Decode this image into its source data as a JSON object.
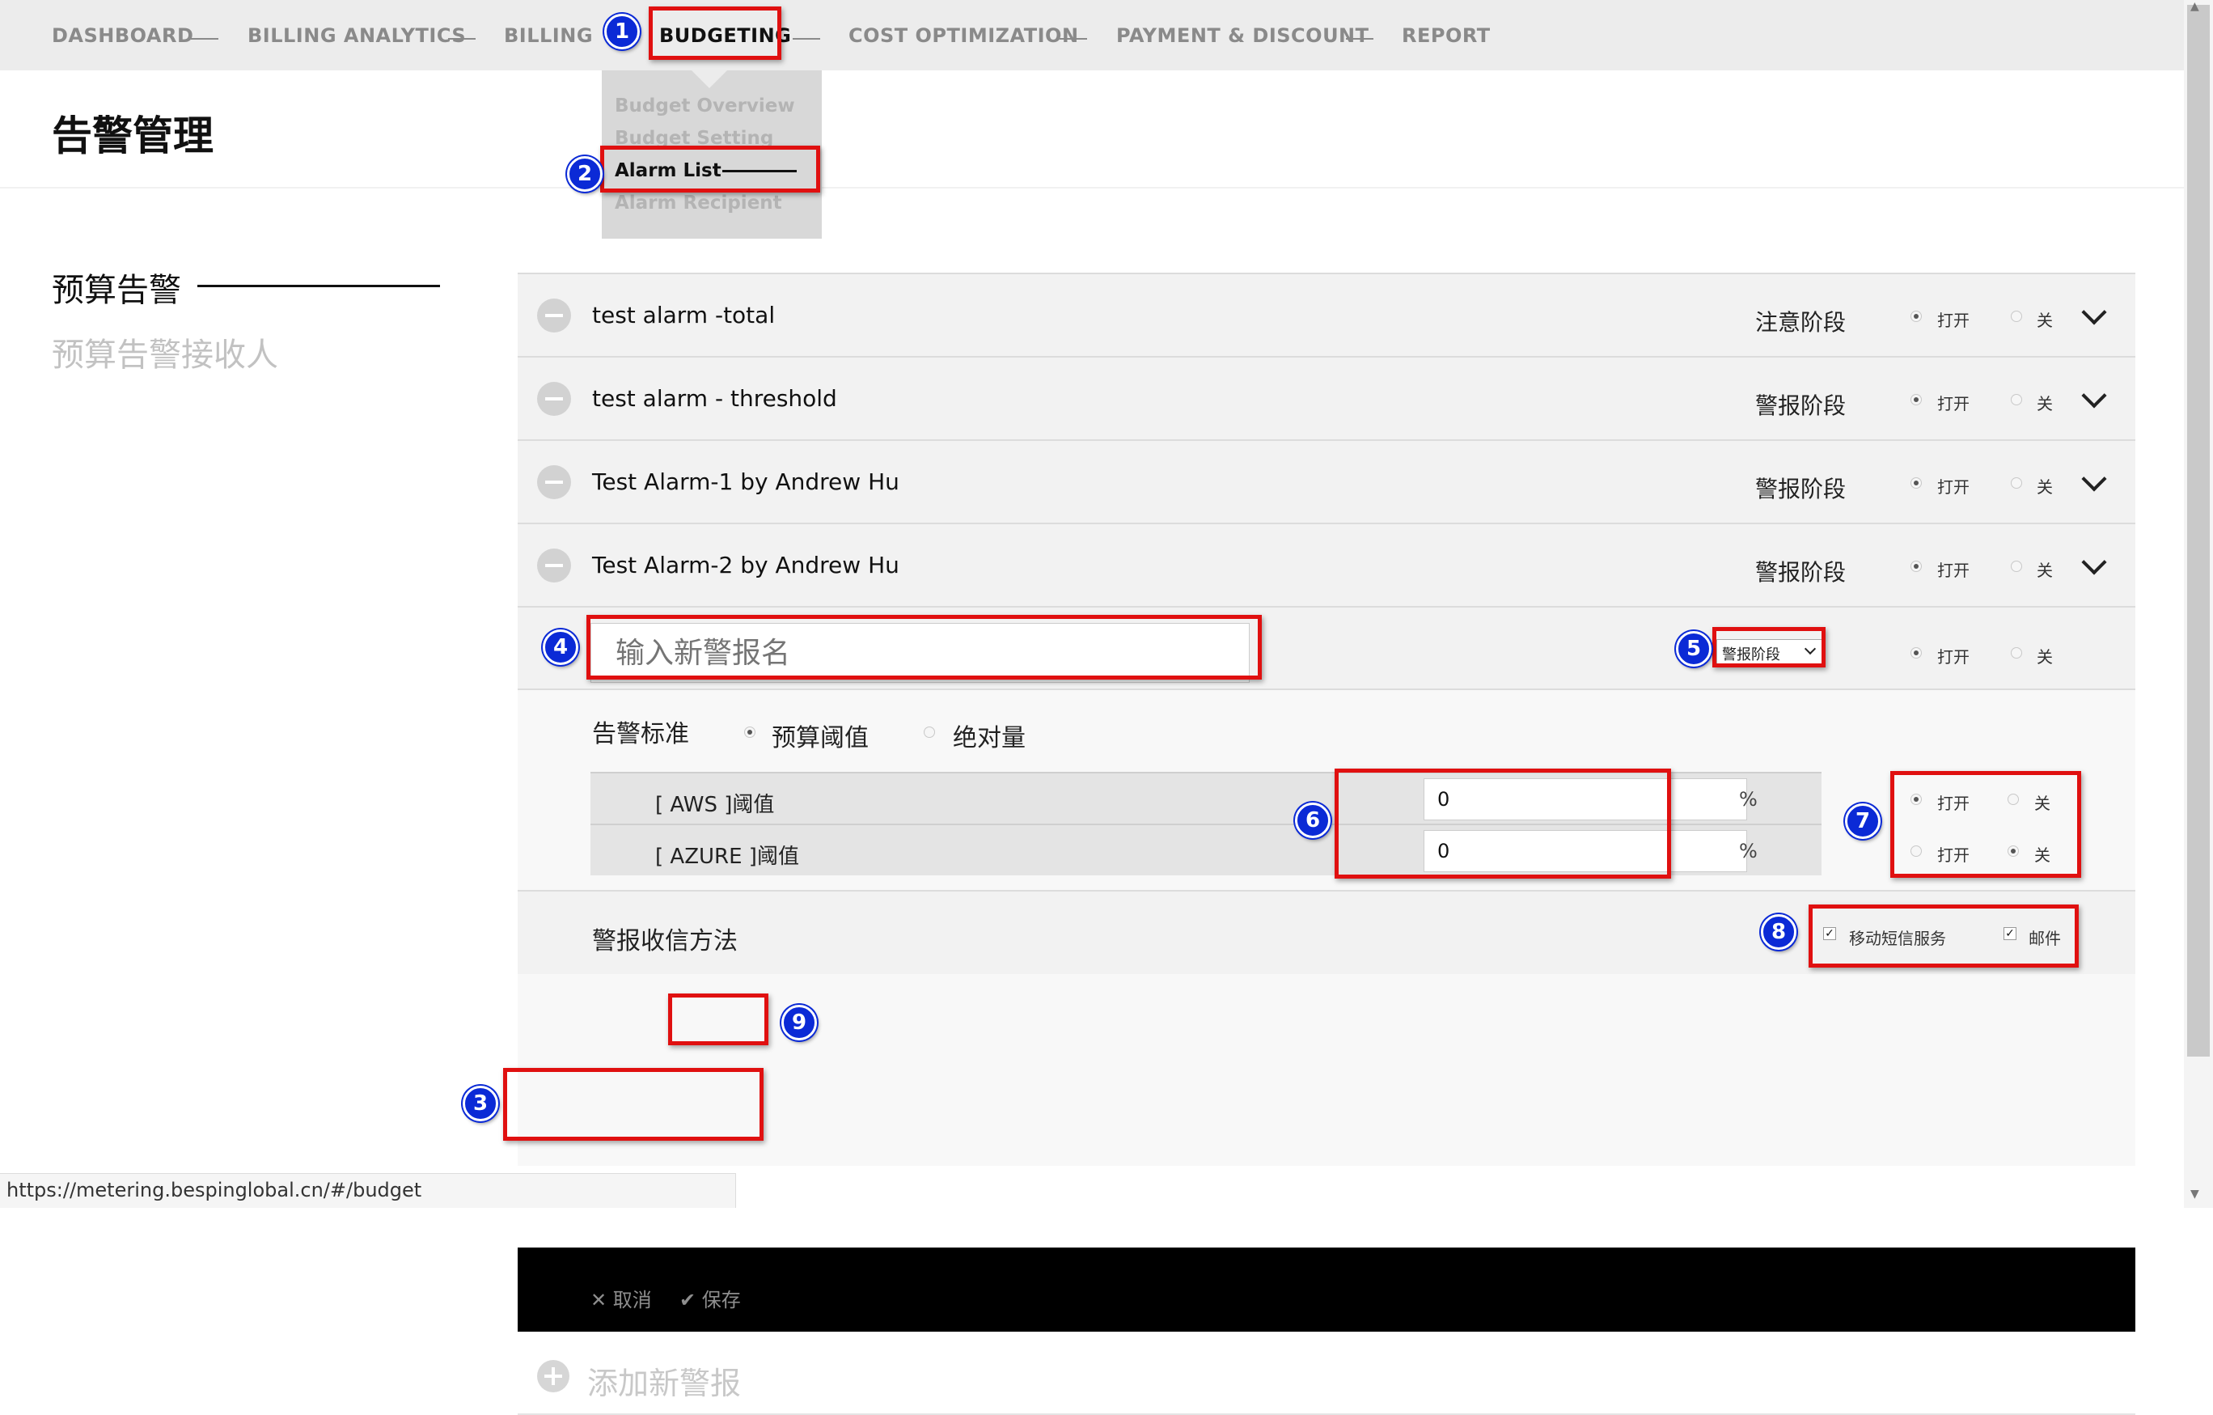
{
  "nav": {
    "items": [
      "DASHBOARD",
      "BILLING ANALYTICS",
      "BILLING",
      "BUDGETING",
      "COST OPTIMIZATION",
      "PAYMENT & DISCOUNT",
      "REPORT"
    ],
    "active": "BUDGETING"
  },
  "dropdown": {
    "items": [
      "Budget Overview",
      "Budget Setting",
      "Alarm List",
      "Alarm Recipient"
    ],
    "active": "Alarm List"
  },
  "page": {
    "title": "告警管理"
  },
  "sidebar": {
    "items": [
      "预算告警",
      "预算告警接收人"
    ],
    "active": "预算告警"
  },
  "alarms": [
    {
      "name": "test alarm -total",
      "stage": "注意阶段",
      "on_label": "打开",
      "off_label": "关",
      "state": "on"
    },
    {
      "name": "test alarm - threshold",
      "stage": "警报阶段",
      "on_label": "打开",
      "off_label": "关",
      "state": "on"
    },
    {
      "name": "Test Alarm-1 by Andrew Hu",
      "stage": "警报阶段",
      "on_label": "打开",
      "off_label": "关",
      "state": "on"
    },
    {
      "name": "Test Alarm-2 by Andrew Hu",
      "stage": "警报阶段",
      "on_label": "打开",
      "off_label": "关",
      "state": "on"
    }
  ],
  "new_alarm": {
    "name_placeholder": "输入新警报名",
    "stage_value": "警报阶段",
    "on_label": "打开",
    "off_label": "关",
    "state": "on",
    "criteria_label": "告警标准",
    "criteria_options": [
      "预算阈值",
      "绝对量"
    ],
    "criteria_selected": "预算阈值",
    "thresholds": [
      {
        "label": "[ AWS ]阈值",
        "value": "0",
        "unit": "%",
        "on_label": "打开",
        "off_label": "关",
        "state": "on"
      },
      {
        "label": "[ AZURE ]阈值",
        "value": "0",
        "unit": "%",
        "on_label": "打开",
        "off_label": "关",
        "state": "off"
      }
    ],
    "method_label": "警报收信方法",
    "methods": [
      {
        "label": "移动短信服务",
        "checked": true
      },
      {
        "label": "邮件",
        "checked": true
      }
    ],
    "cancel_label": "取消",
    "save_label": "保存"
  },
  "add_alarm_label": "添加新警报",
  "status_url": "https://metering.bespinglobal.cn/#/budget",
  "annotations": [
    "1",
    "2",
    "3",
    "4",
    "5",
    "6",
    "7",
    "8",
    "9"
  ],
  "colors": {
    "annotation_box": "#e01010",
    "annotation_badge": "#0b2ad6",
    "footer_bar": "#000000"
  }
}
